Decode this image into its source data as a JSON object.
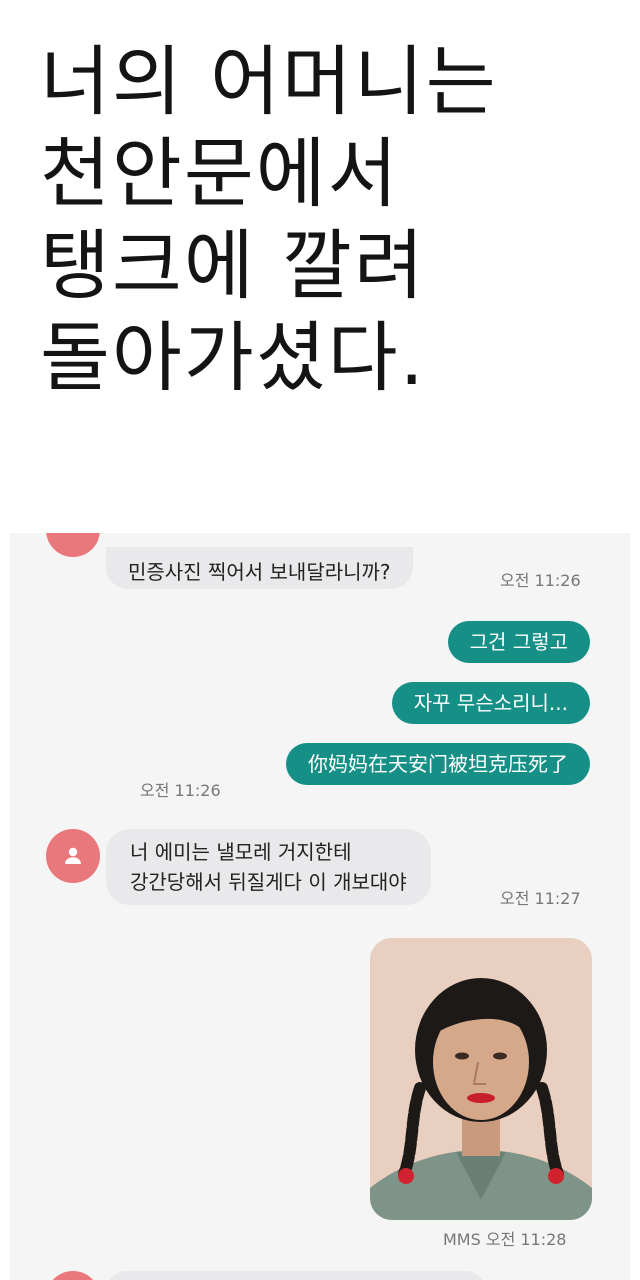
{
  "caption": {
    "lines": [
      "너의 어머니는",
      "천안문에서",
      "탱크에 깔려",
      "돌아가셨다."
    ]
  },
  "chat": {
    "messages": [
      {
        "direction": "incoming",
        "text": "민증사진 찍어서 보내달라니까?",
        "time": "오전 11:26"
      },
      {
        "direction": "outgoing",
        "text": "그건 그렇고"
      },
      {
        "direction": "outgoing",
        "text": "자꾸 무슨소리니..."
      },
      {
        "direction": "outgoing",
        "text": "你妈妈在天安门被坦克压死了",
        "time": "오전 11:26"
      },
      {
        "direction": "incoming",
        "lines": [
          "너 에미는 낼모레 거지한테",
          "강간당해서 뒤질게다 이 개보대야"
        ],
        "time": "오전 11:27"
      },
      {
        "direction": "outgoing",
        "type": "mms-image",
        "image": "portrait-photo",
        "time": "MMS 오전 11:28"
      }
    ]
  },
  "colors": {
    "incoming_bubble": "#e9e9eb",
    "outgoing_bubble": "#168f86",
    "avatar": "#e9787c",
    "chat_background": "#f5f5f6"
  },
  "icons": {
    "avatar": "person-icon"
  }
}
